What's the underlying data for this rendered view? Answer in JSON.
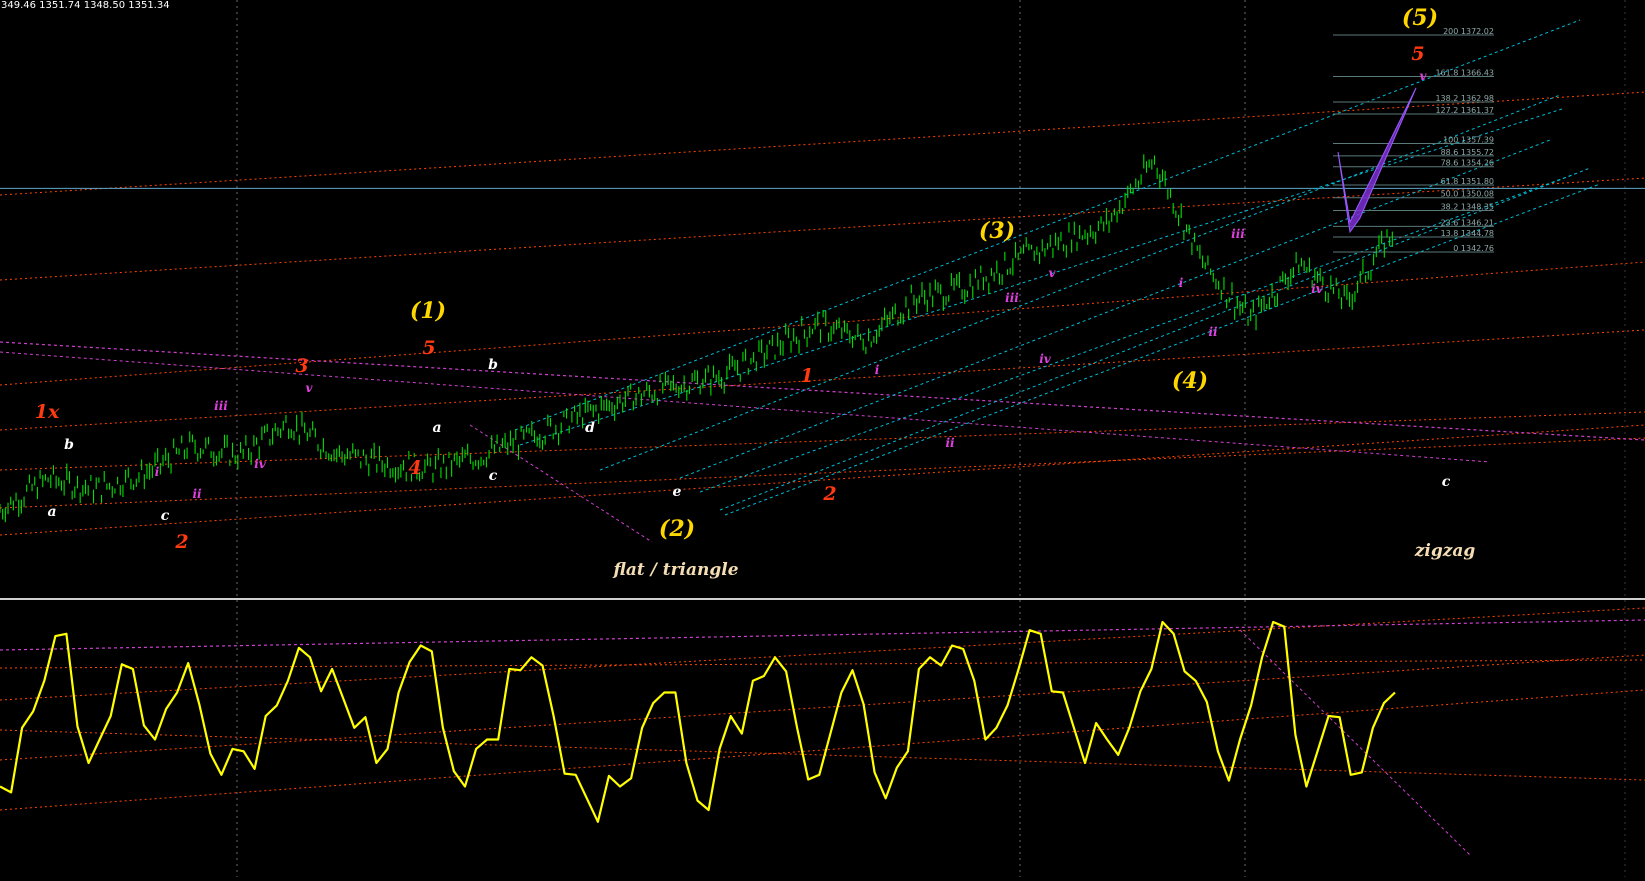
{
  "header": {
    "ohlc_text": "349.46 1351.74 1348.50 1351.34"
  },
  "colors": {
    "background": "#000000",
    "price_candles": "#00e000",
    "oscillator": "#ffff00",
    "fib_levels": "#5a7a7a",
    "channel": "#00bcd4",
    "trend_dotted": "#ff4500",
    "magenta_dotted": "#d040d0",
    "current_price_line": "#5fa8c8",
    "wave_yellow": "#ffd700",
    "wave_red": "#ff3a10",
    "wave_white": "#ffffff",
    "wave_magenta": "#e040e0",
    "harmonic_fill": "#7b2fd0"
  },
  "chart_data": {
    "type": "line",
    "main_price": {
      "approx_close_path": [
        1345.4,
        1346.6,
        1346.2,
        1346.8,
        1347.9,
        1347.5,
        1348.8,
        1347.6,
        1347.2,
        1347.0,
        1347.5,
        1348.2,
        1349.0,
        1349.7,
        1350.2,
        1350.6,
        1351.6,
        1352.6,
        1352.0,
        1353.6,
        1354.0,
        1355.0,
        1355.8,
        1356.5,
        1359.0,
        1355.0,
        1352.8,
        1355.0,
        1353.5,
        1356.4
      ]
    },
    "fibonacci_levels": [
      {
        "ratio": "200",
        "price": "1372.02"
      },
      {
        "ratio": "161.8",
        "price": "1366.43"
      },
      {
        "ratio": "138.2",
        "price": "1362.98"
      },
      {
        "ratio": "127.2",
        "price": "1361.37"
      },
      {
        "ratio": "100",
        "price": "1357.39"
      },
      {
        "ratio": "88.6",
        "price": "1355.72"
      },
      {
        "ratio": "78.6",
        "price": "1354.26"
      },
      {
        "ratio": "61.8",
        "price": "1351.80"
      },
      {
        "ratio": "50.0",
        "price": "1350.08"
      },
      {
        "ratio": "38.2",
        "price": "1348.35"
      },
      {
        "ratio": "23.6",
        "price": "1346.21"
      },
      {
        "ratio": "13.8",
        "price": "1344.78"
      },
      {
        "ratio": "0",
        "price": "1342.76"
      }
    ],
    "oscillator": {
      "approx_values": [
        30,
        55,
        75,
        95,
        40,
        60,
        80,
        50,
        70,
        65,
        35,
        45,
        60,
        75,
        85,
        80,
        55,
        40,
        70,
        90,
        55,
        30,
        50,
        80,
        85,
        60,
        35,
        15,
        30,
        55,
        70,
        40,
        20,
        60,
        75,
        85,
        55,
        35,
        70,
        65,
        25,
        45,
        85,
        90,
        75,
        55,
        80,
        95,
        70,
        40,
        50,
        55,
        80,
        95,
        75,
        45,
        50,
        85,
        98,
        30,
        60,
        35,
        55,
        70
      ]
    },
    "annotations": {
      "wave_labels": [
        {
          "text": "(1)",
          "color": "yellow"
        },
        {
          "text": "(2)",
          "color": "yellow"
        },
        {
          "text": "(3)",
          "color": "yellow"
        },
        {
          "text": "(4)",
          "color": "yellow"
        },
        {
          "text": "(5)",
          "color": "yellow"
        },
        {
          "text": "1x",
          "color": "red"
        },
        {
          "text": "2",
          "color": "red"
        },
        {
          "text": "3",
          "color": "red"
        },
        {
          "text": "4",
          "color": "red"
        },
        {
          "text": "5",
          "color": "red"
        },
        {
          "text": "1",
          "color": "red"
        },
        {
          "text": "2",
          "color": "red"
        },
        {
          "text": "5",
          "color": "red"
        },
        {
          "text": "a",
          "color": "white"
        },
        {
          "text": "b",
          "color": "white"
        },
        {
          "text": "c",
          "color": "white"
        },
        {
          "text": "a",
          "color": "white"
        },
        {
          "text": "b",
          "color": "white"
        },
        {
          "text": "c",
          "color": "white"
        },
        {
          "text": "d",
          "color": "white"
        },
        {
          "text": "e",
          "color": "white"
        },
        {
          "text": "c",
          "color": "white"
        },
        {
          "text": "i",
          "color": "magenta"
        },
        {
          "text": "ii",
          "color": "magenta"
        },
        {
          "text": "iii",
          "color": "magenta"
        },
        {
          "text": "iv",
          "color": "magenta"
        },
        {
          "text": "v",
          "color": "magenta"
        },
        {
          "text": "i",
          "color": "magenta"
        },
        {
          "text": "ii",
          "color": "magenta"
        },
        {
          "text": "iii",
          "color": "magenta"
        },
        {
          "text": "iv",
          "color": "magenta"
        },
        {
          "text": "v",
          "color": "magenta"
        },
        {
          "text": "i",
          "color": "magenta"
        },
        {
          "text": "ii",
          "color": "magenta"
        },
        {
          "text": "iii",
          "color": "magenta"
        },
        {
          "text": "iv",
          "color": "magenta"
        },
        {
          "text": "v",
          "color": "magenta"
        }
      ],
      "notes": [
        "flat / triangle",
        "zigzag"
      ]
    }
  }
}
